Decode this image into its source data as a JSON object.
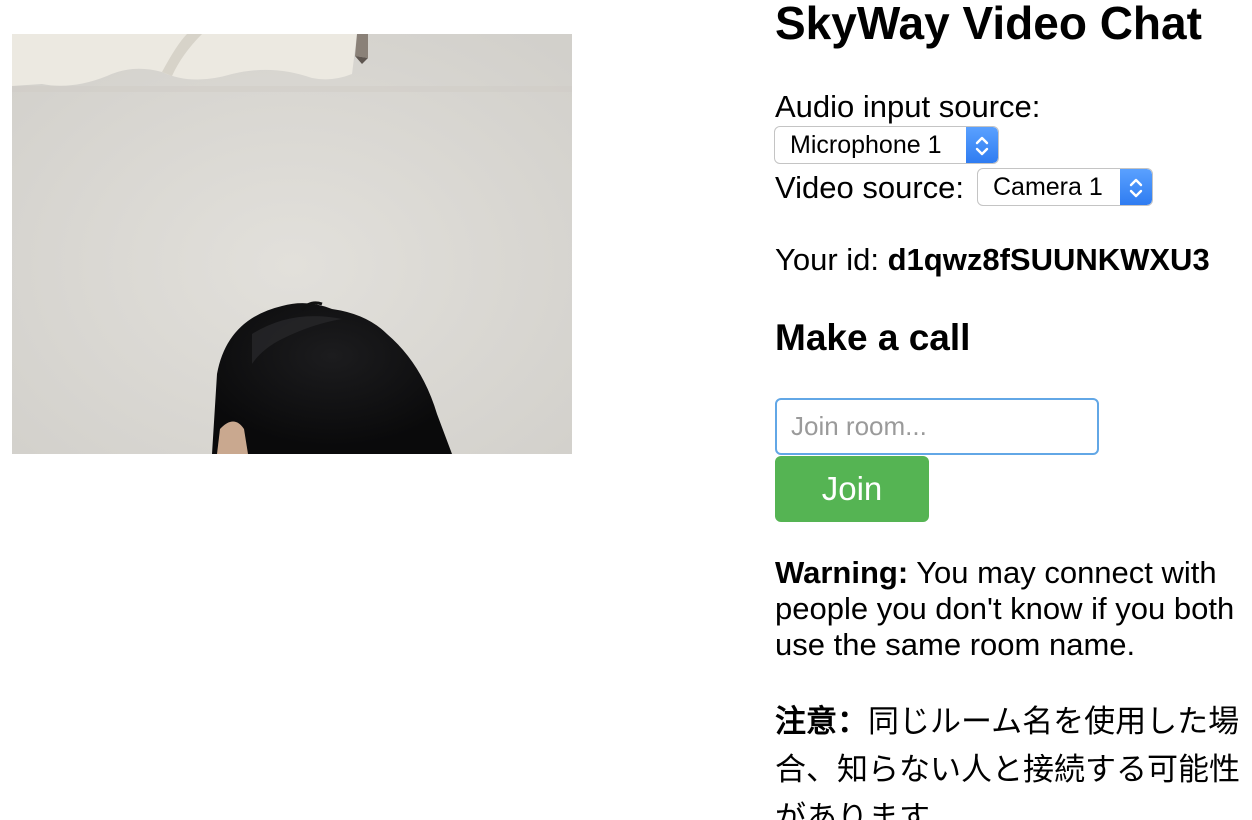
{
  "app": {
    "title": "SkyWay Video Chat"
  },
  "video": {
    "description_icon": "camera-preview"
  },
  "devices": {
    "audio_label": "Audio input source:",
    "audio_selected": "Microphone 1",
    "video_label": "Video source:",
    "video_selected": "Camera 1"
  },
  "identity": {
    "prefix": "Your id: ",
    "id": "d1qwz8fSUUNKWXU3"
  },
  "call": {
    "heading": "Make a call",
    "room_placeholder": "Join room...",
    "room_value": "",
    "join_label": "Join"
  },
  "warning_en": {
    "label": "Warning:",
    "text": " You may connect with people you don't know if you both use the same room name."
  },
  "warning_ja": {
    "label": "注意：",
    "text": "同じルーム名を使用した場合、知らない人と接続する可能性があります。"
  },
  "colors": {
    "join_button": "#55b453",
    "input_focus_border": "#62a7e6",
    "select_arrow": "#2f7cf1"
  }
}
